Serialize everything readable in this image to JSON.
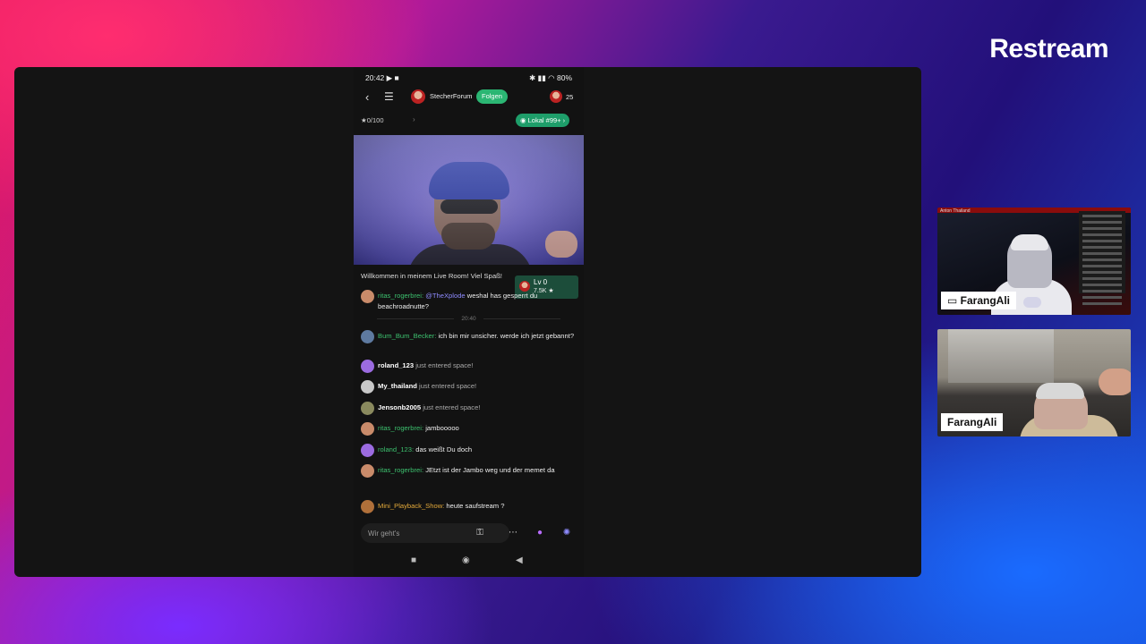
{
  "brand": "Restream",
  "phone": {
    "status": {
      "time": "20:42",
      "icons": "▶ ■",
      "right_icons": "✱ ▮▮ ◠",
      "battery": "80"
    },
    "header": {
      "channel": "StecherForum",
      "follow": "Folgen",
      "viewers": "25"
    },
    "subbar": {
      "score": "0/100",
      "local": "Lokal #99+"
    },
    "welcome": "Willkommen in meinem Live Room! Viel Spaß!",
    "level_badge": {
      "level": "Lv 0",
      "value": "7.5K"
    },
    "timestamp": "20:40",
    "messages": [
      {
        "user": "ritas_rogerbrei:",
        "mention": "@TheXplode",
        "text": " weshal has gesperrt du beachroadnutte?",
        "style": "green",
        "avatar": "#c98b6a"
      },
      {
        "user": "Bum_Bum_Becker:",
        "mention": "",
        "text": " ich bin mir unsicher. werde ich jetzt gebannt?",
        "style": "green",
        "avatar": "#5e7aa0"
      },
      {
        "user": "roland_123",
        "mention": "",
        "text": " just entered space!",
        "style": "bold",
        "avatar": "#9b6be0"
      },
      {
        "user": "My_thailand",
        "mention": "",
        "text": " just entered space!",
        "style": "bold",
        "avatar": "#c8c8c8"
      },
      {
        "user": "Jensonb2005",
        "mention": "",
        "text": " just entered space!",
        "style": "bold",
        "avatar": "#8a8a5e"
      },
      {
        "user": "ritas_rogerbrei:",
        "mention": "",
        "text": " jambooooo",
        "style": "green",
        "avatar": "#c98b6a"
      },
      {
        "user": "roland_123:",
        "mention": "",
        "text": " das weißt Du doch",
        "style": "green",
        "avatar": "#9b6be0"
      },
      {
        "user": "ritas_rogerbrei:",
        "mention": "",
        "text": " JEtzt ist der Jambo weg und der memet da",
        "style": "green",
        "avatar": "#c98b6a"
      },
      {
        "user": "Mini_Playback_Show:",
        "mention": "",
        "text": " heute saufstream ?",
        "style": "gold",
        "avatar": "#b0703a"
      }
    ],
    "input_placeholder": "Wir geht's"
  },
  "tiles": [
    {
      "label": "FarangAli",
      "title": "Anton Thailand"
    },
    {
      "label": "FarangAli"
    }
  ],
  "colors": {
    "accent_green": "#2bb673",
    "stage": "#141414"
  }
}
